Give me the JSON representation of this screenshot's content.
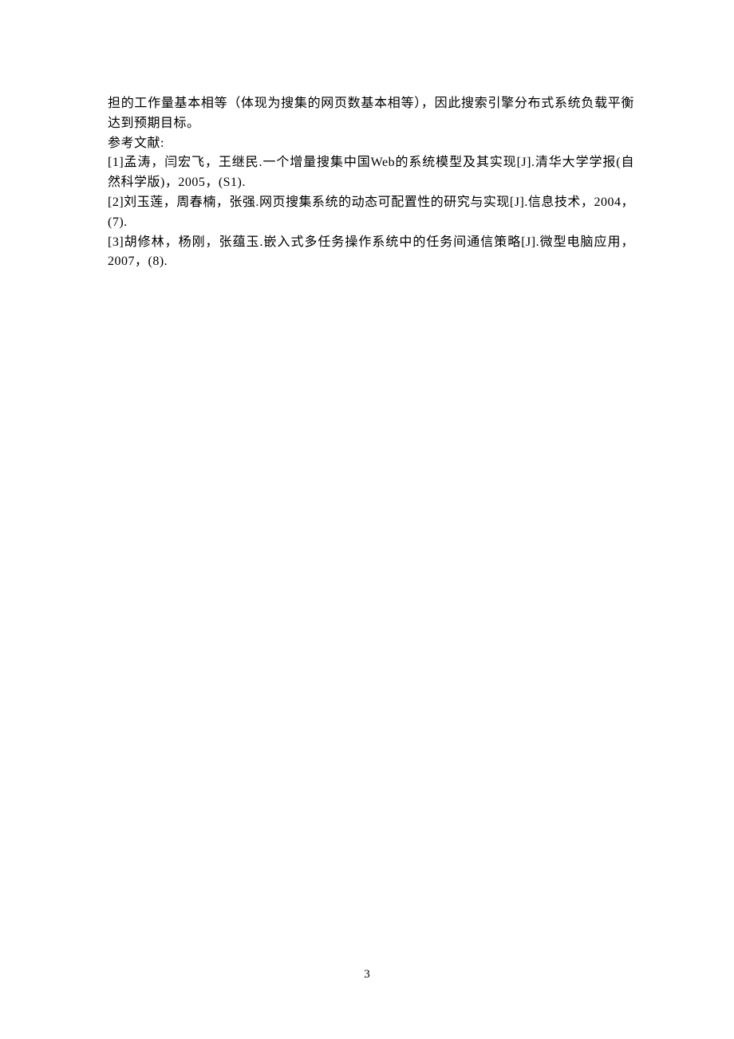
{
  "body": {
    "paragraph": "担的工作量基本相等（体现为搜集的网页数基本相等），因此搜索引擎分布式系统负载平衡达到预期目标。"
  },
  "references": {
    "heading": "参考文献:",
    "entries": [
      "[1]孟涛，闫宏飞，王继民.一个增量搜集中国Web的系统模型及其实现[J].清华大学学报(自然科学版)，2005，(S1).",
      "[2]刘玉莲，周春楠，张强.网页搜集系统的动态可配置性的研究与实现[J].信息技术，2004，(7).",
      "[3]胡修林，杨刚，张蕴玉.嵌入式多任务操作系统中的任务间通信策略[J].微型电脑应用，2007，(8)."
    ]
  },
  "page_number": "3"
}
